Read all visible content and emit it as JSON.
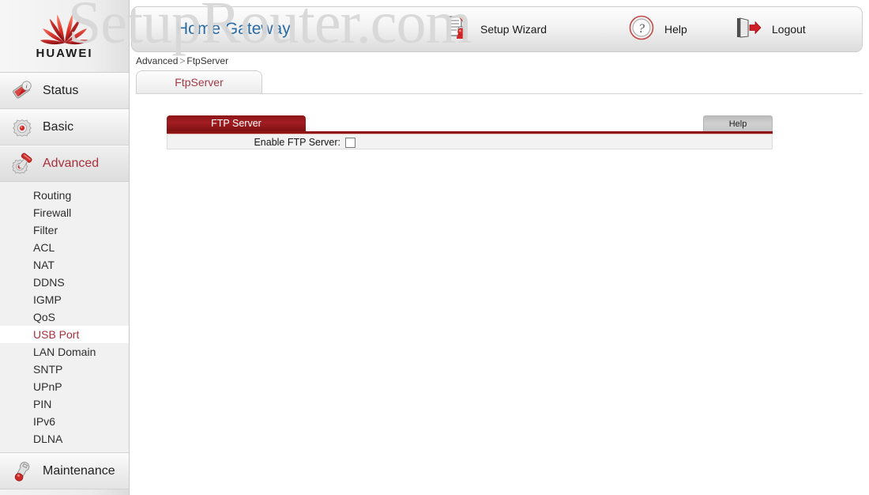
{
  "watermark": {
    "text": "SetupRouter.com"
  },
  "brand": {
    "logo_name": "huawei-logo",
    "wordmark": "HUAWEI"
  },
  "header": {
    "title": "Home Gateway",
    "items": [
      {
        "id": "setup-wizard",
        "label": "Setup Wizard",
        "icon": "setup-wizard-icon"
      },
      {
        "id": "help",
        "label": "Help",
        "icon": "question-mark-icon"
      },
      {
        "id": "logout",
        "label": "Logout",
        "icon": "logout-door-icon"
      }
    ]
  },
  "breadcrumb": {
    "parent": "Advanced",
    "separator": ">",
    "current": "FtpServer"
  },
  "tabs": [
    {
      "id": "ftpserver",
      "label": "FtpServer",
      "active": true
    }
  ],
  "sidebar": {
    "main_items": [
      {
        "id": "status",
        "label": "Status",
        "icon": "status-tag-icon",
        "active": false
      },
      {
        "id": "basic",
        "label": "Basic",
        "icon": "gear-icon",
        "active": false
      },
      {
        "id": "advanced",
        "label": "Advanced",
        "icon": "advanced-gear-tool-icon",
        "active": true
      },
      {
        "id": "maintenance",
        "label": "Maintenance",
        "icon": "wrench-icon",
        "active": false
      }
    ],
    "advanced_subitems": [
      {
        "id": "routing",
        "label": "Routing",
        "selected": false
      },
      {
        "id": "firewall",
        "label": "Firewall",
        "selected": false
      },
      {
        "id": "filter",
        "label": "Filter",
        "selected": false
      },
      {
        "id": "acl",
        "label": "ACL",
        "selected": false
      },
      {
        "id": "nat",
        "label": "NAT",
        "selected": false
      },
      {
        "id": "ddns",
        "label": "DDNS",
        "selected": false
      },
      {
        "id": "igmp",
        "label": "IGMP",
        "selected": false
      },
      {
        "id": "qos",
        "label": "QoS",
        "selected": false
      },
      {
        "id": "usb-port",
        "label": "USB Port",
        "selected": true
      },
      {
        "id": "lan-domain",
        "label": "LAN Domain",
        "selected": false
      },
      {
        "id": "sntp",
        "label": "SNTP",
        "selected": false
      },
      {
        "id": "upnp",
        "label": "UPnP",
        "selected": false
      },
      {
        "id": "pin",
        "label": "PIN",
        "selected": false
      },
      {
        "id": "ipv6",
        "label": "IPv6",
        "selected": false
      },
      {
        "id": "dlna",
        "label": "DLNA",
        "selected": false
      }
    ]
  },
  "panel": {
    "title": "FTP Server",
    "help_label": "Help",
    "rows": [
      {
        "id": "enable-ftp-server",
        "label": "Enable FTP Server:",
        "type": "checkbox",
        "checked": false
      }
    ]
  },
  "colors": {
    "panel_red": "#8f1515",
    "title_blue": "#2b6ca3",
    "accent_red": "#a8303b",
    "sidebar_bg": "#ececec",
    "panel_body_bg": "#f2f2f2"
  }
}
